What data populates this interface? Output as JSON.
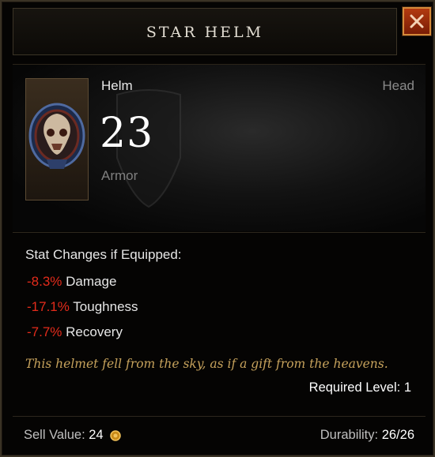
{
  "window": {
    "title": "STAR HELM",
    "close_icon": "close-icon"
  },
  "item": {
    "type": "Helm",
    "slot": "Head",
    "armor_value": "23",
    "armor_label": "Armor",
    "icon": "helm-icon"
  },
  "stats": {
    "heading": "Stat Changes if Equipped:",
    "rows": [
      {
        "value": "-8.3%",
        "label": " Damage"
      },
      {
        "value": "-17.1%",
        "label": " Toughness"
      },
      {
        "value": "-7.7%",
        "label": " Recovery"
      }
    ]
  },
  "flavor_text": "This helmet fell from the sky, as if a gift from the heavens.",
  "required_level": "Required Level: 1",
  "footer": {
    "sell_label": "Sell Value: ",
    "sell_amount": "24",
    "durability_label": "Durability: ",
    "durability_amount": "26/26"
  },
  "colors": {
    "stat_negative": "#e32b1b",
    "flavor": "#c6a25c",
    "close_button": "#b23a10"
  }
}
